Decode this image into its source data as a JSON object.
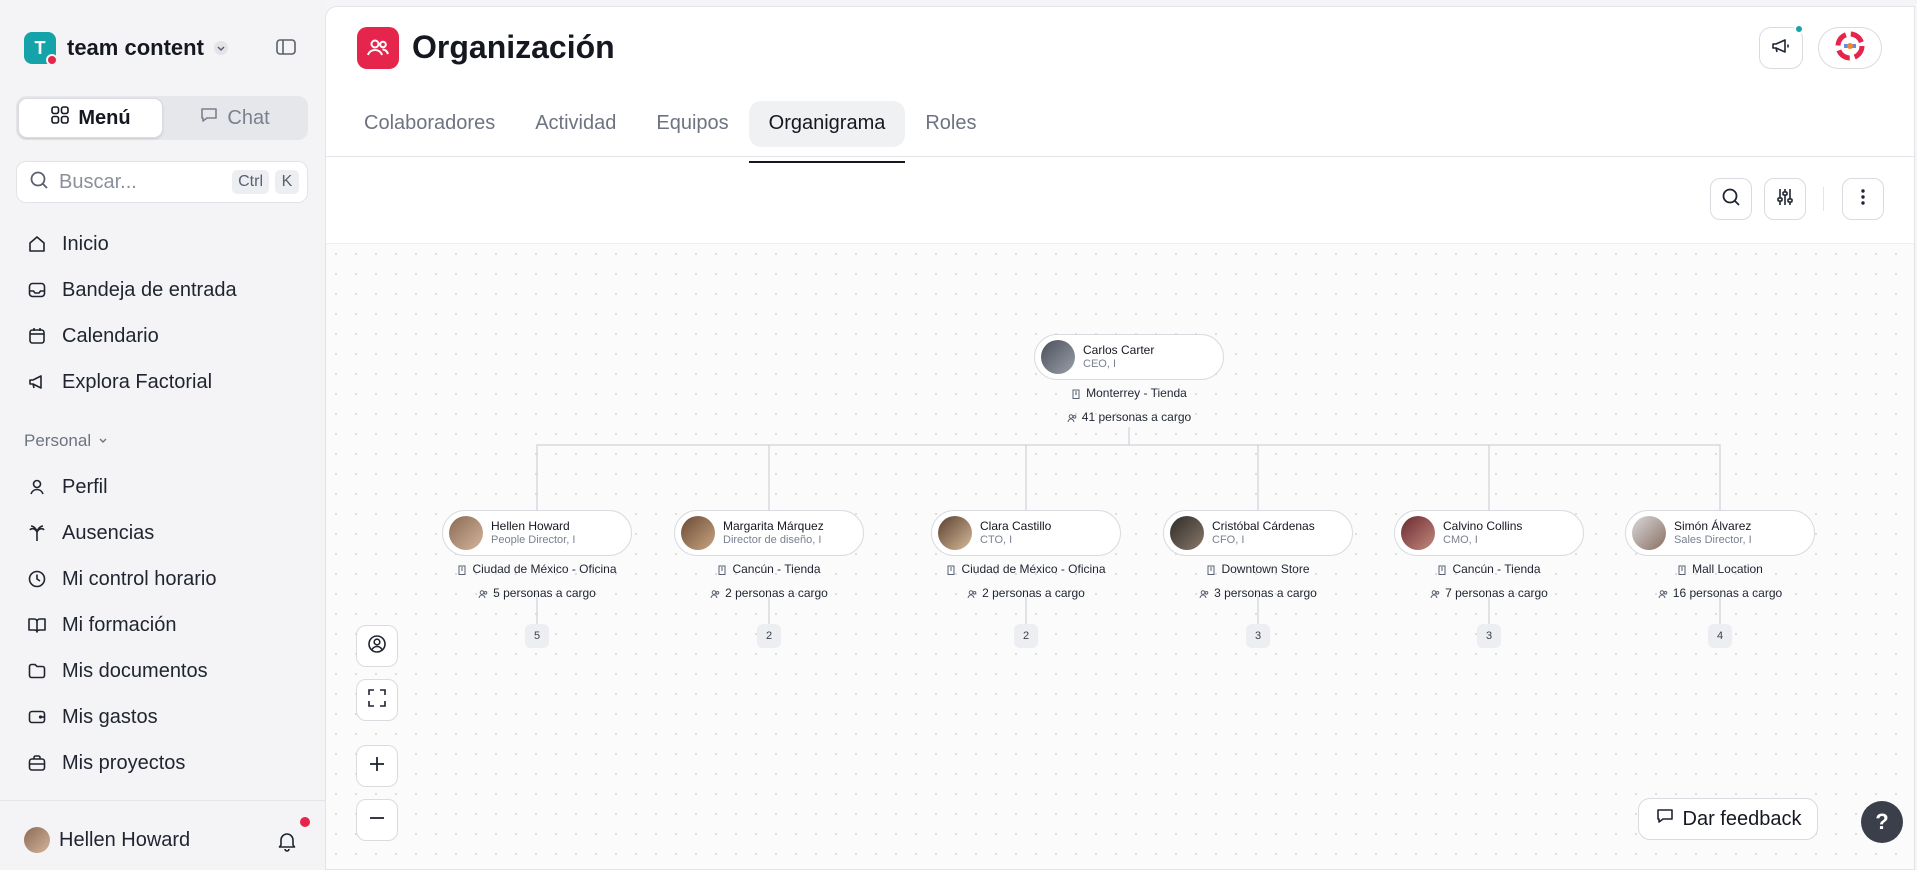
{
  "sidebar": {
    "workspace_initial": "T",
    "workspace_name": "team content",
    "segmented": {
      "menu_label": "Menú",
      "chat_label": "Chat"
    },
    "search": {
      "placeholder": "Buscar...",
      "shortcut_1": "Ctrl",
      "shortcut_2": "K"
    },
    "items": [
      {
        "label": "Inicio",
        "icon": "home-icon"
      },
      {
        "label": "Bandeja de entrada",
        "icon": "inbox-icon"
      },
      {
        "label": "Calendario",
        "icon": "calendar-icon"
      },
      {
        "label": "Explora Factorial",
        "icon": "megaphone-icon"
      }
    ],
    "personal_section": "Personal",
    "personal_items": [
      {
        "label": "Perfil",
        "icon": "user-icon"
      },
      {
        "label": "Ausencias",
        "icon": "palm-tree-icon"
      },
      {
        "label": "Mi control horario",
        "icon": "clock-icon"
      },
      {
        "label": "Mi formación",
        "icon": "book-icon"
      },
      {
        "label": "Mis documentos",
        "icon": "folder-icon"
      },
      {
        "label": "Mis gastos",
        "icon": "wallet-icon"
      },
      {
        "label": "Mis proyectos",
        "icon": "briefcase-icon"
      }
    ],
    "user_name": "Hellen Howard"
  },
  "header": {
    "title": "Organización",
    "tabs": [
      {
        "label": "Colaboradores",
        "active": false
      },
      {
        "label": "Actividad",
        "active": false
      },
      {
        "label": "Equipos",
        "active": false
      },
      {
        "label": "Organigrama",
        "active": true
      },
      {
        "label": "Roles",
        "active": false
      }
    ]
  },
  "org_chart": {
    "root": {
      "name": "Carlos Carter",
      "role": "CEO, I",
      "location": "Monterrey - Tienda",
      "reports": "41 personas a cargo"
    },
    "children": [
      {
        "name": "Hellen Howard",
        "role": "People Director, I",
        "location": "Ciudad de México - Oficina",
        "reports": "5 personas a cargo",
        "count": "5"
      },
      {
        "name": "Margarita Márquez",
        "role": "Director de diseño, I",
        "location": "Cancún - Tienda",
        "reports": "2 personas a cargo",
        "count": "2"
      },
      {
        "name": "Clara Castillo",
        "role": "CTO, I",
        "location": "Ciudad de México - Oficina",
        "reports": "2 personas a cargo",
        "count": "2"
      },
      {
        "name": "Cristóbal Cárdenas",
        "role": "CFO, I",
        "location": "Downtown Store",
        "reports": "3 personas a cargo",
        "count": "3"
      },
      {
        "name": "Calvino Collins",
        "role": "CMO, I",
        "location": "Cancún - Tienda",
        "reports": "7 personas a cargo",
        "count": "3"
      },
      {
        "name": "Simón Álvarez",
        "role": "Sales Director, I",
        "location": "Mall Location",
        "reports": "16 personas a cargo",
        "count": "4"
      }
    ]
  },
  "footer": {
    "feedback_label": "Dar feedback",
    "help_label": "?"
  },
  "colors": {
    "brand_teal": "#14a3a8",
    "accent_red": "#e5254b"
  }
}
